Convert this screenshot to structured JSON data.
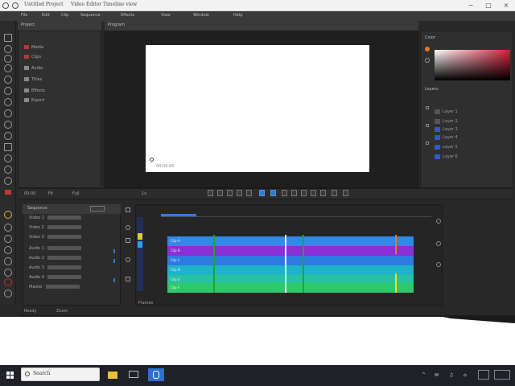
{
  "window": {
    "title_parts": [
      "Untitled Project",
      "Video Editor",
      "Timeline view"
    ],
    "minimize_glyph": "−",
    "maximize_glyph": "□",
    "close_glyph": "×"
  },
  "menu": [
    "File",
    "Edit",
    "Clip",
    "Sequence",
    "Effects",
    "View",
    "Window",
    "Help"
  ],
  "project_panel": {
    "title": "Project",
    "rows": [
      "Media",
      "Clips",
      "Audio",
      "Titles",
      "Effects",
      "Export"
    ]
  },
  "viewer": {
    "title": "Program",
    "caption": "00:00:00"
  },
  "right_panel": {
    "color_title": "Color",
    "layers_title": "Layers",
    "layers": [
      "Layer 1",
      "Layer 2",
      "Layer 3",
      "Layer 4",
      "Layer 5",
      "Layer 6"
    ]
  },
  "transport": {
    "left_labels": [
      "00:00",
      "Fit",
      "Full"
    ],
    "right_label": "1x"
  },
  "timeline_list": {
    "title": "Sequence",
    "rows": [
      "Video 1",
      "Video 2",
      "Video 3",
      "Audio 1",
      "Audio 2",
      "Audio 3",
      "Audio 4",
      "Master"
    ]
  },
  "timeline": {
    "playhead_fraction": 0.13,
    "lanes": [
      {
        "color": "#2f8ae6",
        "label": "Clip A"
      },
      {
        "color": "#8a2fd6",
        "label": "Clip B"
      },
      {
        "color": "#2d7ae0",
        "label": "Clip C"
      },
      {
        "color": "#1fb3c9",
        "label": "Clip D"
      },
      {
        "color": "#27c2a0",
        "label": "Clip E"
      },
      {
        "color": "#2fc86b",
        "label": "Clip F"
      }
    ]
  },
  "status": [
    "Ready",
    "Zoom",
    "Frames"
  ],
  "taskbar": {
    "search_placeholder": "Search",
    "tray": [
      "^",
      "✉",
      "♫",
      "⌂"
    ]
  },
  "colors": {
    "accent": "#2f7bd8",
    "panel": "#303030",
    "background": "#282828"
  }
}
